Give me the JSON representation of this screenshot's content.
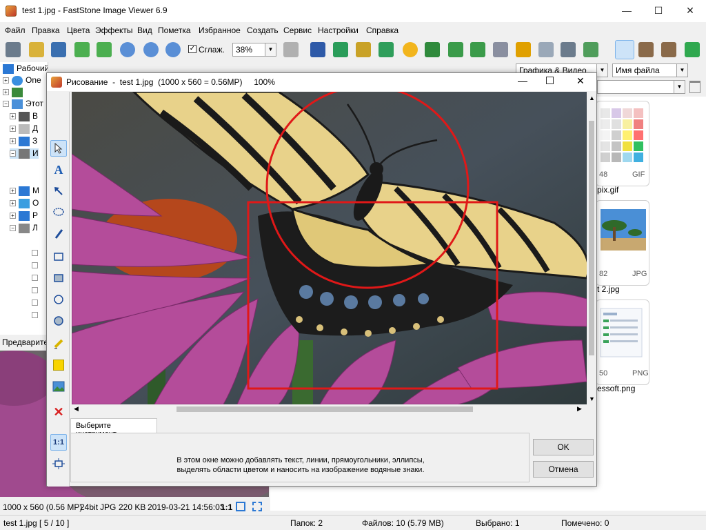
{
  "window": {
    "title": "test 1.jpg  -  FastStone Image Viewer 6.9",
    "minimize_glyph": "—",
    "maximize_glyph": "☐",
    "close_glyph": "✕"
  },
  "menu": [
    "Файл",
    "Правка",
    "Цвета",
    "Эффекты",
    "Вид",
    "Пометка",
    "Избранное",
    "Создать",
    "Сервис",
    "Настройки",
    "Справка"
  ],
  "toolbar": {
    "smooth_label": "Сглаж.",
    "zoom_value": "38%"
  },
  "browser": {
    "filter_value": "Графика & Видео",
    "sort_value": "Имя файла"
  },
  "tree": {
    "items": [
      {
        "label": "Рабочий стол"
      },
      {
        "label": "One"
      },
      {
        "label": ""
      },
      {
        "label": "Этот"
      },
      {
        "label": "В"
      },
      {
        "label": "Д"
      },
      {
        "label": "З"
      },
      {
        "label": "И"
      },
      {
        "label": "М"
      },
      {
        "label": "О"
      },
      {
        "label": "Р"
      },
      {
        "label": "Л"
      }
    ]
  },
  "preview": {
    "header": "Предварите"
  },
  "image_info": {
    "dimensions": "1000 x 560 (0.56 MP)",
    "depth": "24bit",
    "format": "JPG",
    "size": "220 KB",
    "date": "2019-03-21 14:56:03",
    "ratio": "1:1"
  },
  "status": {
    "file": "test 1.jpg [ 5 / 10 ]",
    "folders": "Папок: 2",
    "files": "Файлов: 10 (5.79 MB)",
    "selected": "Выбрано: 1",
    "marked": "Помечено: 0"
  },
  "thumbnails": [
    {
      "info": "48",
      "format": "GIF",
      "name": "pix.gif"
    },
    {
      "info": "82",
      "format": "JPG",
      "name": "t 2.jpg"
    },
    {
      "info": "50",
      "format": "PNG",
      "name": "essoft.png"
    }
  ],
  "dialog": {
    "title": "Рисование  -  test 1.jpg  (1000 x 560 = 0.56MP)     100%",
    "tab_label": "Выберите инструмент",
    "hint_line1": "В этом окне можно добавлять текст, линии, прямоугольники, эллипсы,",
    "hint_line2": "выделять области цветом и наносить на изображение водяные знаки.",
    "ok_label": "OK",
    "cancel_label": "Отмена",
    "ratio_label": "1:1"
  },
  "colors": {
    "annotation_red": "#e01818",
    "selection_blue": "#0078d7",
    "toolbar_active": "#cde3f8"
  }
}
